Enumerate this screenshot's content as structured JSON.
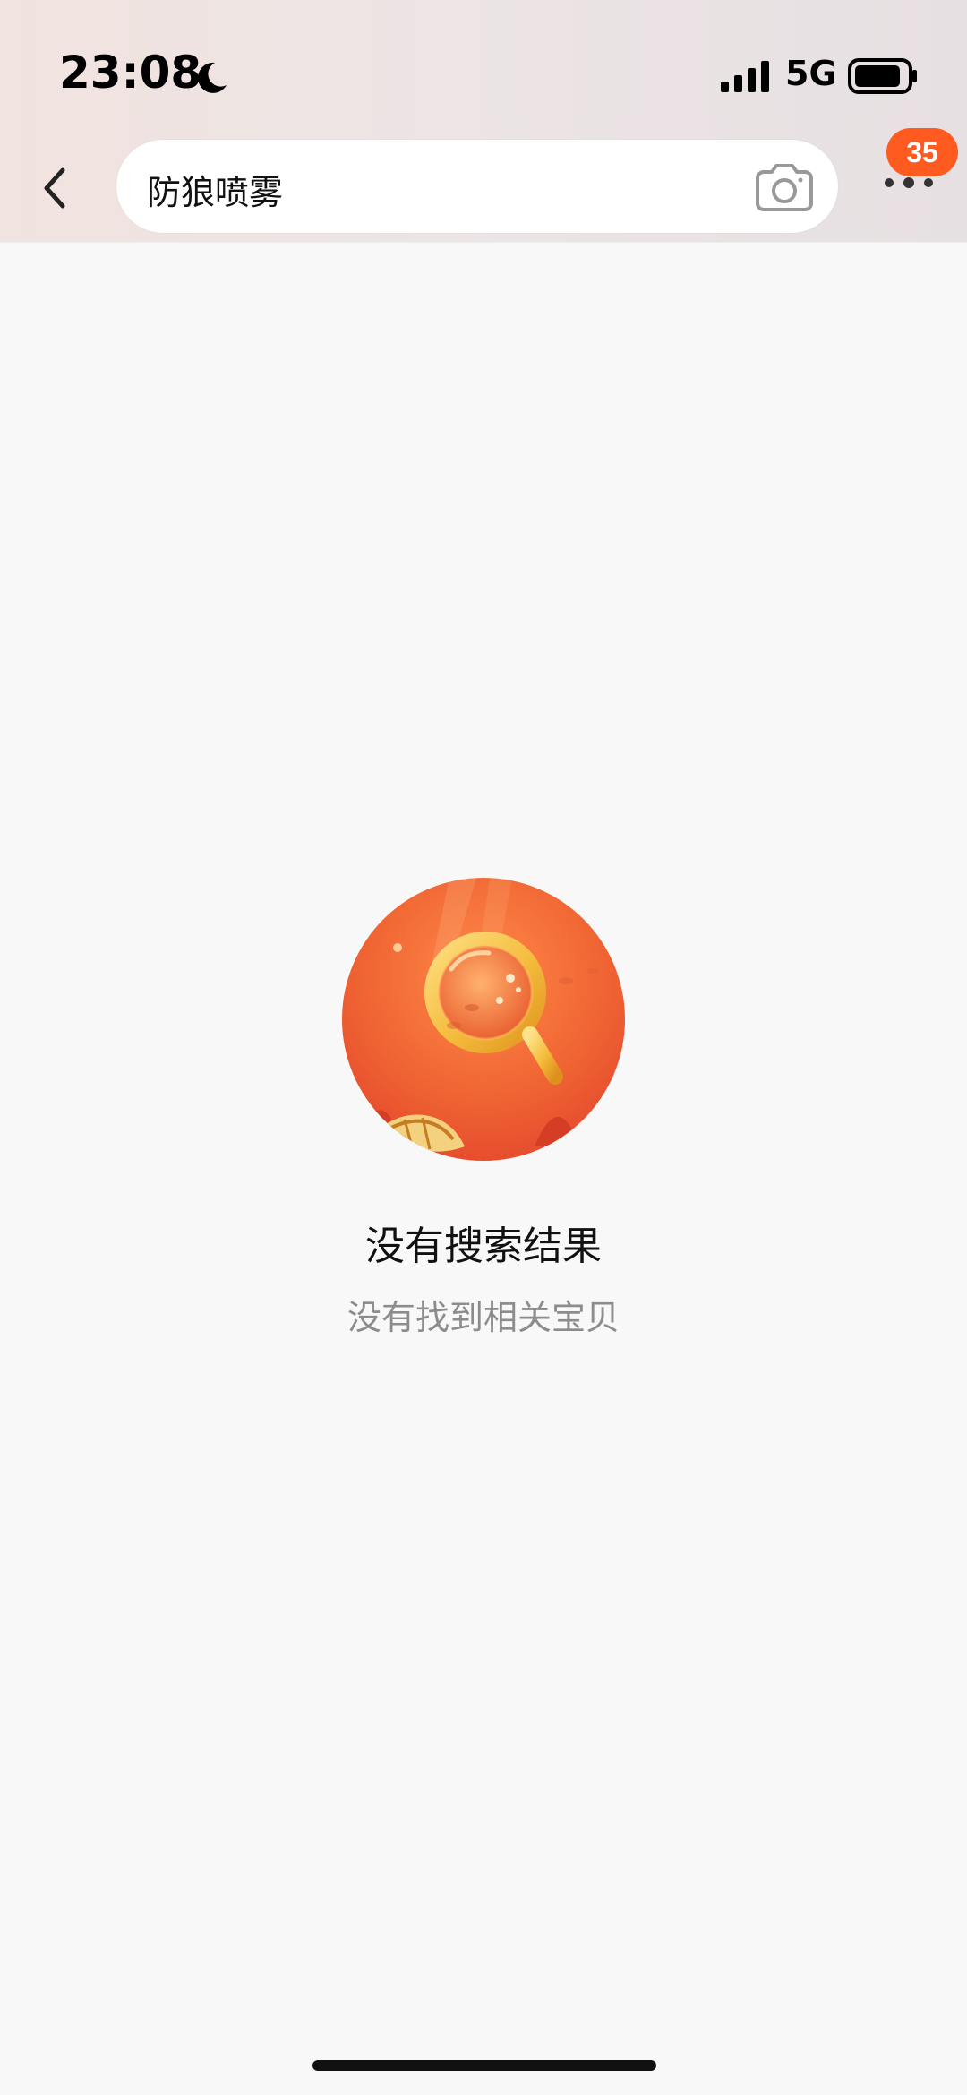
{
  "status_bar": {
    "time": "23:08",
    "network": "5G"
  },
  "search": {
    "query": "防狼喷雾"
  },
  "header": {
    "message_badge_count": "35"
  },
  "empty_state": {
    "title": "没有搜索结果",
    "subtitle": "没有找到相关宝贝"
  },
  "colors": {
    "badge": "#ff5a1f",
    "illustration_orange": "#f05a2b",
    "page_background": "#f8f8f8"
  },
  "icons": {
    "back": "chevron-left",
    "camera": "camera",
    "more": "three-dots",
    "moon": "moon",
    "signal": "signal-bars",
    "battery": "battery"
  }
}
